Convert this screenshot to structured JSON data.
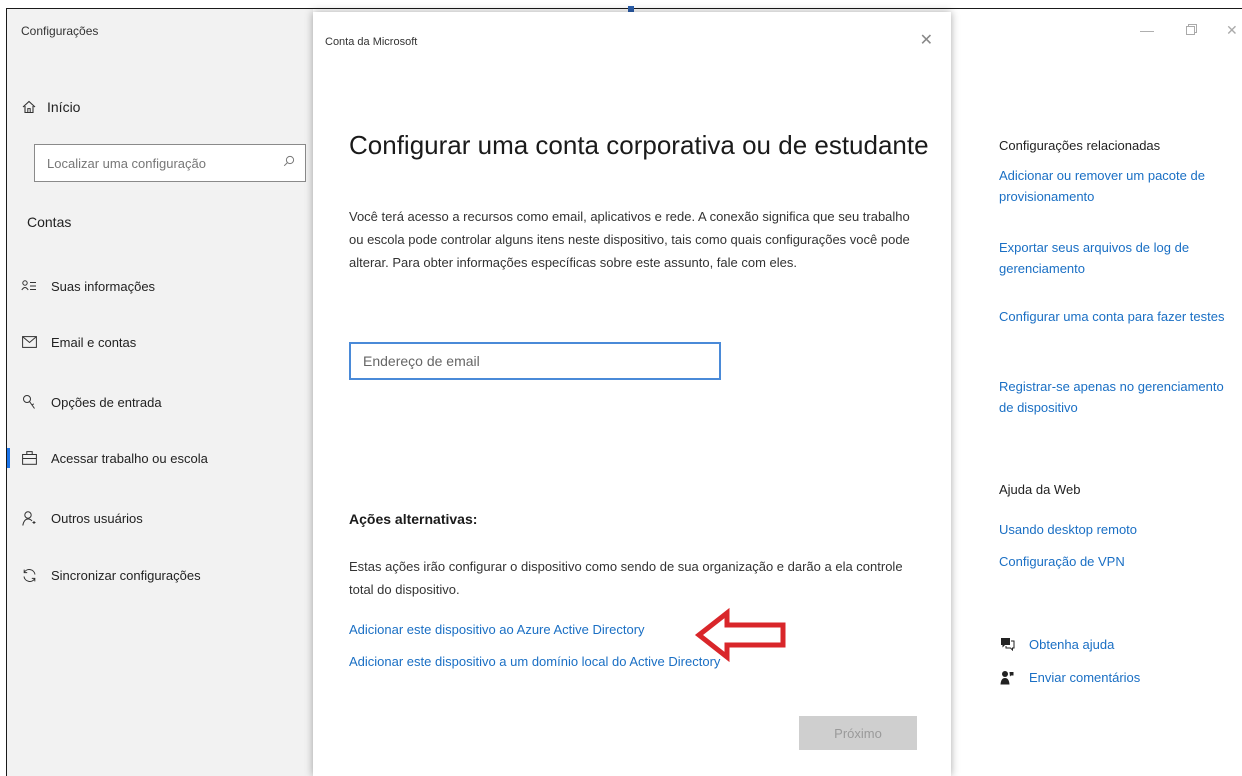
{
  "app": {
    "title": "Configurações"
  },
  "sidebar": {
    "home_label": "Início",
    "search_placeholder": "Localizar uma configuração",
    "section_title": "Contas",
    "items": [
      {
        "label": "Suas informações",
        "icon": "person-card-icon"
      },
      {
        "label": "Email e contas",
        "icon": "mail-icon"
      },
      {
        "label": "Opções de entrada",
        "icon": "key-icon"
      },
      {
        "label": "Acessar trabalho ou escola",
        "icon": "briefcase-icon",
        "active": true
      },
      {
        "label": "Outros usuários",
        "icon": "person-add-icon"
      },
      {
        "label": "Sincronizar configurações",
        "icon": "sync-icon"
      }
    ]
  },
  "dialog": {
    "title": "Conta da Microsoft",
    "heading": "Configurar uma conta corporativa ou de estudante",
    "description": "Você terá acesso a recursos como email, aplicativos e rede. A conexão significa que seu trabalho ou escola pode controlar alguns itens neste dispositivo, tais como quais configurações você pode alterar. Para obter informações específicas sobre este assunto, fale com eles.",
    "email_placeholder": "Endereço de email",
    "alt_heading": "Ações alternativas:",
    "alt_description": "Estas ações irão configurar o dispositivo como sendo de sua organização e darão a ela controle total do dispositivo.",
    "link_azure": "Adicionar este dispositivo ao Azure Active Directory",
    "link_local": "Adicionar este dispositivo a um domínio local do Active Directory",
    "next_label": "Próximo"
  },
  "related": {
    "title": "Configurações relacionadas",
    "links": [
      "Adicionar ou remover um pacote de provisionamento",
      "Exportar seus arquivos de log de gerenciamento",
      "Configurar uma conta para fazer testes",
      "Registrar-se apenas no gerenciamento de dispositivo"
    ]
  },
  "web_help": {
    "title": "Ajuda da Web",
    "links": [
      "Usando desktop remoto",
      "Configuração de VPN"
    ]
  },
  "help": {
    "get_help": "Obtenha ajuda",
    "feedback": "Enviar comentários"
  },
  "colors": {
    "link": "#1a6fc4",
    "accent": "#1a73e8",
    "annotation_arrow": "#d9262a"
  }
}
